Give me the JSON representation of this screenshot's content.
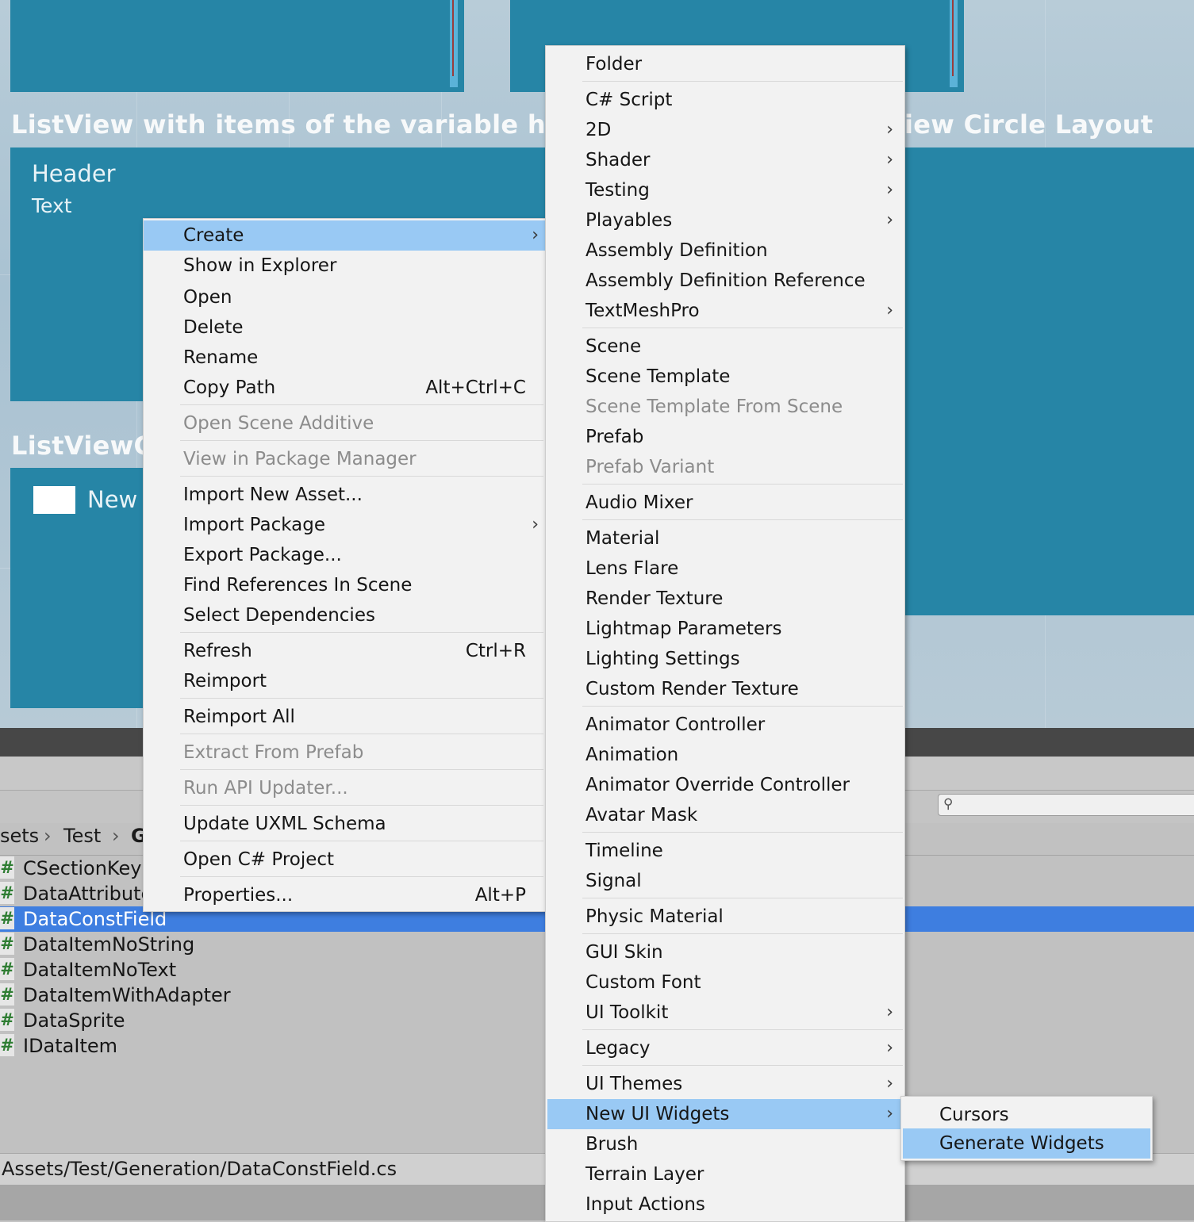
{
  "scene": {
    "title_left": "ListView with items of the variable height",
    "title_right": "iew Circle Layout",
    "title_bottom": "ListViewC",
    "header_label": "Header",
    "header_text": "Text",
    "new_label": "New"
  },
  "project": {
    "breadcrumb": [
      "sets",
      "Test",
      "G"
    ],
    "files": [
      {
        "name": "CSectionKey",
        "selected": false
      },
      {
        "name": "DataAttribute",
        "selected": false
      },
      {
        "name": "DataConstField",
        "selected": true
      },
      {
        "name": "DataItemNoString",
        "selected": false
      },
      {
        "name": "DataItemNoText",
        "selected": false
      },
      {
        "name": "DataItemWithAdapter",
        "selected": false
      },
      {
        "name": "DataSprite",
        "selected": false
      },
      {
        "name": "IDataItem",
        "selected": false
      }
    ],
    "file_icon": "#",
    "path": "Assets/Test/Generation/DataConstField.cs",
    "search_icon": "search-icon"
  },
  "context_menu": {
    "items": [
      {
        "label": "Create",
        "submenu": true,
        "highlighted": true
      },
      {
        "label": "Show in Explorer"
      },
      {
        "label": "Open"
      },
      {
        "label": "Delete"
      },
      {
        "label": "Rename"
      },
      {
        "label": "Copy Path",
        "shortcut": "Alt+Ctrl+C"
      },
      {
        "label": "Open Scene Additive",
        "disabled": true
      },
      {
        "label": "View in Package Manager",
        "disabled": true
      },
      {
        "label": "Import New Asset..."
      },
      {
        "label": "Import Package",
        "submenu": true
      },
      {
        "label": "Export Package..."
      },
      {
        "label": "Find References In Scene"
      },
      {
        "label": "Select Dependencies"
      },
      {
        "label": "Refresh",
        "shortcut": "Ctrl+R"
      },
      {
        "label": "Reimport"
      },
      {
        "label": "Reimport All"
      },
      {
        "label": "Extract From Prefab",
        "disabled": true
      },
      {
        "label": "Run API Updater...",
        "disabled": true
      },
      {
        "label": "Update UXML Schema"
      },
      {
        "label": "Open C# Project"
      },
      {
        "label": "Properties...",
        "shortcut": "Alt+P"
      }
    ]
  },
  "create_menu": {
    "items": [
      {
        "label": "Folder"
      },
      {
        "label": "C# Script"
      },
      {
        "label": "2D",
        "submenu": true
      },
      {
        "label": "Shader",
        "submenu": true
      },
      {
        "label": "Testing",
        "submenu": true
      },
      {
        "label": "Playables",
        "submenu": true
      },
      {
        "label": "Assembly Definition"
      },
      {
        "label": "Assembly Definition Reference"
      },
      {
        "label": "TextMeshPro",
        "submenu": true
      },
      {
        "label": "Scene"
      },
      {
        "label": "Scene Template"
      },
      {
        "label": "Scene Template From Scene",
        "disabled": true
      },
      {
        "label": "Prefab"
      },
      {
        "label": "Prefab Variant",
        "disabled": true
      },
      {
        "label": "Audio Mixer"
      },
      {
        "label": "Material"
      },
      {
        "label": "Lens Flare"
      },
      {
        "label": "Render Texture"
      },
      {
        "label": "Lightmap Parameters"
      },
      {
        "label": "Lighting Settings"
      },
      {
        "label": "Custom Render Texture"
      },
      {
        "label": "Animator Controller"
      },
      {
        "label": "Animation"
      },
      {
        "label": "Animator Override Controller"
      },
      {
        "label": "Avatar Mask"
      },
      {
        "label": "Timeline"
      },
      {
        "label": "Signal"
      },
      {
        "label": "Physic Material"
      },
      {
        "label": "GUI Skin"
      },
      {
        "label": "Custom Font"
      },
      {
        "label": "UI Toolkit",
        "submenu": true
      },
      {
        "label": "Legacy",
        "submenu": true
      },
      {
        "label": "UI Themes",
        "submenu": true
      },
      {
        "label": "New UI Widgets",
        "submenu": true,
        "highlighted": true
      },
      {
        "label": "Brush"
      },
      {
        "label": "Terrain Layer"
      },
      {
        "label": "Input Actions"
      }
    ]
  },
  "widgets_menu": {
    "items": [
      {
        "label": "Cursors"
      },
      {
        "label": "Generate Widgets",
        "highlighted": true
      }
    ]
  },
  "submenu_arrow": "›",
  "colors": {
    "scene_panel": "#2685a6",
    "menu_bg": "#f2f2f2",
    "menu_highlight": "#99c9f4",
    "selection": "#3e7ee0",
    "disabled_text": "#8c8c8c"
  }
}
